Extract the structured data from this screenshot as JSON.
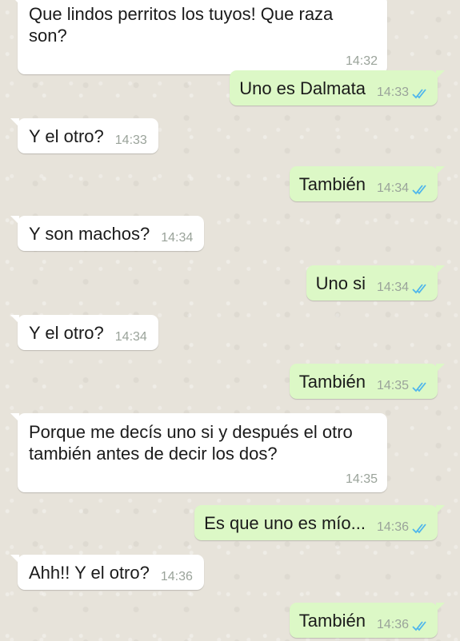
{
  "colors": {
    "incoming_bubble": "#ffffff",
    "outgoing_bubble": "#dcf8c6",
    "timestamp": "#9aa39a",
    "read_check": "#4fb6ec",
    "wallpaper": "#e7e3da"
  },
  "messages": [
    {
      "dir": "in",
      "text": "Que lindos perritos los tuyos! Que raza son?",
      "time": "14:32"
    },
    {
      "dir": "out",
      "text": "Uno es Dalmata",
      "time": "14:33",
      "status_icon": "double-check-icon"
    },
    {
      "dir": "in",
      "text": "Y el otro?",
      "time": "14:33"
    },
    {
      "dir": "out",
      "text": "También",
      "time": "14:34",
      "status_icon": "double-check-icon"
    },
    {
      "dir": "in",
      "text": "Y son machos?",
      "time": "14:34"
    },
    {
      "dir": "out",
      "text": "Uno si",
      "time": "14:34",
      "status_icon": "double-check-icon"
    },
    {
      "dir": "in",
      "text": "Y el otro?",
      "time": "14:34"
    },
    {
      "dir": "out",
      "text": "También",
      "time": "14:35",
      "status_icon": "double-check-icon"
    },
    {
      "dir": "in",
      "text": "Porque me decís uno si y después el otro también antes de decir los dos?",
      "time": "14:35"
    },
    {
      "dir": "out",
      "text": "Es que uno es mío...",
      "time": "14:36",
      "status_icon": "double-check-icon"
    },
    {
      "dir": "in",
      "text": "Ahh!! Y el otro?",
      "time": "14:36"
    },
    {
      "dir": "out",
      "text": "También",
      "time": "14:36",
      "status_icon": "double-check-icon"
    }
  ]
}
